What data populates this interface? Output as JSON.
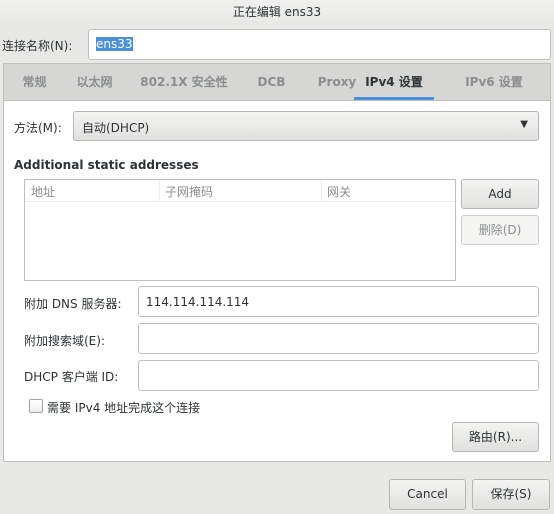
{
  "window": {
    "title": "正在编辑 ens33"
  },
  "connection_name": {
    "label": "连接名称(N):",
    "value": "ens33"
  },
  "tabs": [
    {
      "label": "常规"
    },
    {
      "label": "以太网"
    },
    {
      "label": "802.1X 安全性"
    },
    {
      "label": "DCB"
    },
    {
      "label": "Proxy"
    },
    {
      "label": "IPv4 设置",
      "active": true
    },
    {
      "label": "IPv6 设置"
    }
  ],
  "ipv4": {
    "method_label": "方法(M):",
    "method_value": "自动(DHCP)",
    "static_title": "Additional static addresses",
    "columns": [
      "地址",
      "子网掩码",
      "网关"
    ],
    "add_label": "Add",
    "delete_label": "删除(D)",
    "dns_label": "附加 DNS 服务器:",
    "dns_value": "114.114.114.114",
    "search_label": "附加搜索域(E):",
    "search_value": "",
    "dhcp_label": "DHCP 客户端 ID:",
    "dhcp_value": "",
    "require_label": "需要 IPv4 地址完成这个连接",
    "require_checked": false,
    "routes_label": "路由(R)..."
  },
  "footer": {
    "cancel": "Cancel",
    "save": "保存(S)"
  },
  "colors": {
    "accent": "#4a90d9"
  }
}
